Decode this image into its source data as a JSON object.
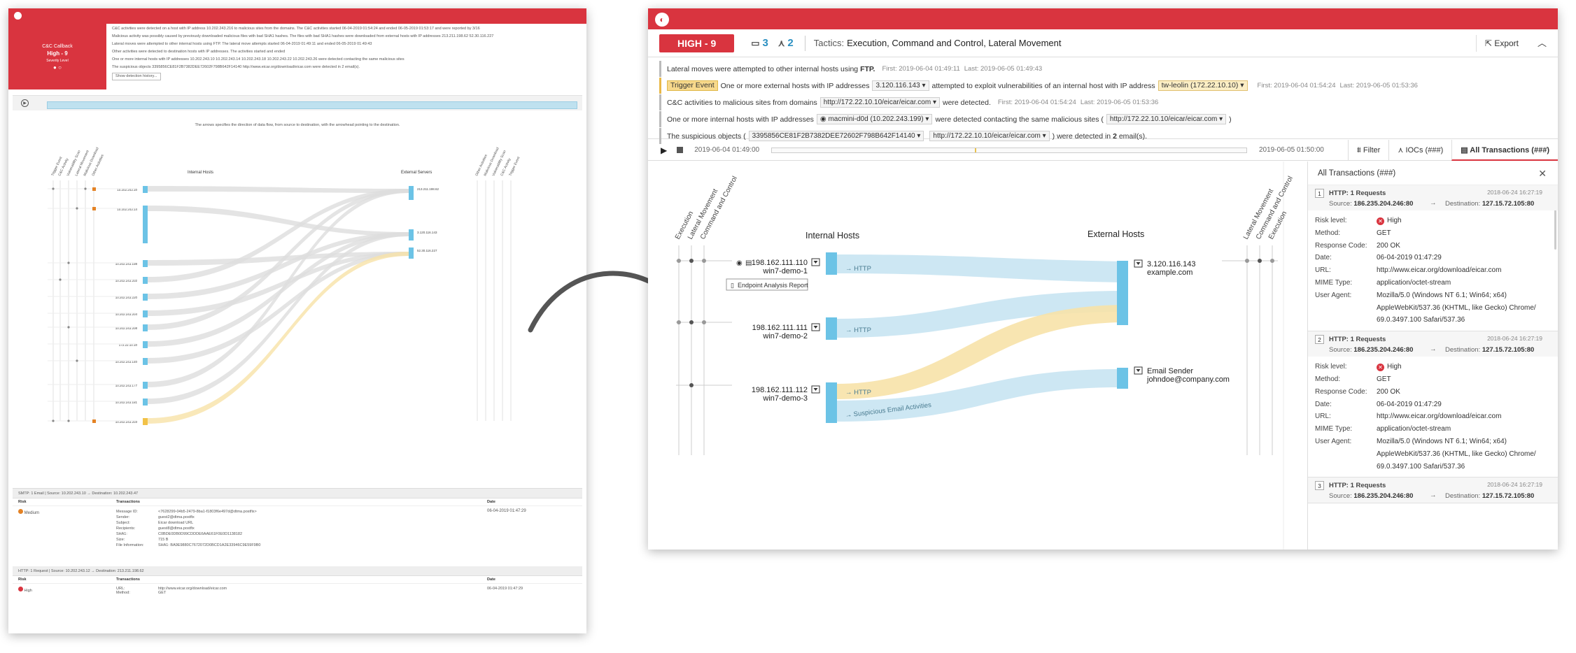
{
  "left": {
    "card": {
      "title": "C&C Callback",
      "level": "High - 9",
      "sub": "Severity Level"
    },
    "summary": [
      "C&C activities were detected on a host with IP address 10.202.243.216 to malicious sites from the domains. The C&C activities started 06-04-2019 01:54:24 and ended 06-05-2019 01:53:17 and were reported by 3/16",
      "Malicious activity was possibly caused by previously downloaded malicious files with bad SHA1 hashes. The files with bad SHA1 hashes were downloaded from external hosts with IP addresses 213.211.198.62 52.30.116.227",
      "Lateral moves were attempted to other internal hosts using FTP. The lateral move attempts started 06-04-2019 01:49:11 and ended 06-05-2019 01:49:43",
      "Other activities were detected to destination hosts with IP addresses. The activities started and ended",
      "One or more internal hosts with IP addresses 10.202.243.10 10.202.243.14 10.202.243.18 10.202.243.22 10.202.243.26 were detected contacting the same malicious sites",
      "The suspicious objects 3395856CE81F2B7382DEE72602F798B642F14140 http://www.eicar.org/download/eicar.com were detected in 2 email(s)."
    ],
    "history_button": "Show detection history...",
    "caption": "The arrows specifies the direction of data flow, from source to destination, with the arrowhead pointing to the destination.",
    "col_internal": "Internal Hosts",
    "col_external": "External Servers",
    "left_cols": [
      "Trigger Event",
      "C&C Activity",
      "Vulnerability Scan",
      "Lateral Movement",
      "Malicious Download",
      "Other Activities"
    ],
    "right_cols": [
      "Other Activities",
      "Malicious Download",
      "Vulnerability Scan",
      "C&C Activity",
      "Trigger Event"
    ],
    "hosts": [
      "10.202.243.10",
      "10.202.243.14",
      "10.202.243.198",
      "10.202.243.202",
      "10.202.243.220",
      "10.202.243.204",
      "10.202.243.208",
      "172.22.10.10",
      "10.202.243.140",
      "10.202.243.177",
      "10.202.243.181",
      "10.202.243.203"
    ],
    "servers": [
      "213.211.198.62",
      "3.120.116.143",
      "52.30.116.227"
    ],
    "table1": {
      "head": "SMTP: 1 Email | Source: 10.202.243.10 → Destination: 10.202.243.47",
      "risk": "Medium",
      "date": "06-04-2019 01:47:29",
      "rows": [
        [
          "Message ID:",
          "<7628299-04b5-2479-8ba1-f1803f6e497d@dtma.postfix>"
        ],
        [
          "Sender:",
          "guest2@dtma.postfix"
        ],
        [
          "Subject:",
          "Eicar download URL"
        ],
        [
          "Recipients:",
          "guest8@dtma.postfix"
        ],
        [
          "SHA1:",
          "C0BDE0DB0D99CDDDE6AAE61F0E0D1138182"
        ],
        [
          "Size:",
          "715 B"
        ],
        [
          "File Information:",
          "SHA1: BA9E9880C7672072D0BCD1A2E33946C9E59F9B0"
        ]
      ]
    },
    "table2": {
      "head": "HTTP: 1 Request | Source: 10.202.243.12 → Destination: 213.211.198.62",
      "risk": "High",
      "date": "06-04-2019 01:47:29",
      "url": "http://www.eicar.org/download/eicar.com",
      "method": "GET"
    },
    "th": [
      "Risk",
      "Transactions",
      "Date"
    ]
  },
  "header": {
    "severity": "HIGH - 9",
    "hosts_count": "3",
    "tactic_count": "2",
    "tactics_label": "Tactics:",
    "tactics": "Execution, Command and Control, Lateral Movement",
    "export": "Export"
  },
  "summary": {
    "l1": {
      "a": "Lateral moves were attempted to other internal hosts using",
      "b": "FTP.",
      "first": "First: 2019-06-04 01:49:11",
      "last": "Last: 2019-06-05 01:49:43"
    },
    "l2": {
      "trigger": "Trigger Event",
      "a": "One or more external hosts with IP addresses",
      "ip": "3.120.116.143",
      "b": "attempted to exploit vulnerabilities of an internal host with IP address",
      "host": "tw-leolin (172.22.10.10)",
      "first": "First: 2019-06-04 01:54:24",
      "last": "Last: 2019-06-05 01:53:36"
    },
    "l3": {
      "a": "C&C activities to malicious sites from domains",
      "url": "http://172.22.10.10/eicar/eicar.com",
      "b": "were detected.",
      "first": "First: 2019-06-04 01:54:24",
      "last": "Last: 2019-06-05 01:53:36"
    },
    "l4": {
      "a": "One or more internal hosts with IP addresses",
      "host": "macmini-d0d (10.202.243.199)",
      "b": "were detected contacting the same malicious sites (",
      "url": "http://172.22.10.10/eicar/eicar.com",
      "c": ")"
    },
    "l5": {
      "a": "The suspicious objects (",
      "hash": "3395856CE81F2B7382DEE72602F798B642F14140",
      "url": "http://172.22.10.10/eicar/eicar.com",
      "b": ") were detected in",
      "n": "2",
      "c": "email(s)."
    }
  },
  "timeline": {
    "start": "2019-06-04 01:49:00",
    "end": "2019-06-05 01:50:00",
    "tabs": [
      "Filter",
      "IOCs (###)",
      "All Transactions (###)"
    ]
  },
  "graph": {
    "internal_title": "Internal Hosts",
    "external_title": "External Hosts",
    "left_cols": [
      "Execution",
      "Lateral Movement",
      "Command and Control"
    ],
    "right_cols": [
      "Lateral Movement",
      "Command and Control",
      "Execution"
    ],
    "hosts": [
      {
        "ip": "198.162.111.110",
        "name": "win7-demo-1"
      },
      {
        "ip": "198.162.111.111",
        "name": "win7-demo-2"
      },
      {
        "ip": "198.162.111.112",
        "name": "win7-demo-3"
      }
    ],
    "servers": [
      {
        "a": "3.120.116.143",
        "b": "example.com"
      },
      {
        "a": "Email Sender",
        "b": "johndoe@company.com"
      }
    ],
    "flows": [
      "→ HTTP",
      "→ HTTP",
      "→ HTTP",
      "→ Suspicious Email Activities"
    ],
    "tooltip": "Endpoint Analysis Report"
  },
  "panel": {
    "title": "All Transactions (###)",
    "labels": {
      "risk": "Risk level:",
      "method": "Method:",
      "code": "Response Code:",
      "date": "Date:",
      "url": "URL:",
      "mime": "MIME Type:",
      "ua": "User Agent:",
      "src": "Source:",
      "dst": "Destination:"
    },
    "cards": [
      {
        "n": "1",
        "title": "HTTP: 1 Requests",
        "dt": "2018-06-24 16:27:19",
        "src": "186.235.204.246:80",
        "dst": "127.15.72.105:80",
        "risk": "High",
        "method": "GET",
        "code": "200 OK",
        "date": "06-04-2019 01:47:29",
        "url": "http://www.eicar.org/download/eicar.com",
        "mime": "application/octet-stream",
        "ua1": "Mozilla/5.0 (Windows NT 6.1; Win64; x64)",
        "ua2": "AppleWebKit/537.36 (KHTML, like Gecko) Chrome/",
        "ua3": "69.0.3497.100 Safari/537.36"
      },
      {
        "n": "2",
        "title": "HTTP: 1 Requests",
        "dt": "2018-06-24 16:27:19",
        "src": "186.235.204.246:80",
        "dst": "127.15.72.105:80",
        "risk": "High",
        "method": "GET",
        "code": "200 OK",
        "date": "06-04-2019 01:47:29",
        "url": "http://www.eicar.org/download/eicar.com",
        "mime": "application/octet-stream",
        "ua1": "Mozilla/5.0 (Windows NT 6.1; Win64; x64)",
        "ua2": "AppleWebKit/537.36 (KHTML, like Gecko) Chrome/",
        "ua3": "69.0.3497.100 Safari/537.36"
      },
      {
        "n": "3",
        "title": "HTTP: 1 Requests",
        "dt": "2018-06-24 16:27:19",
        "src": "186.235.204.246:80",
        "dst": "127.15.72.105:80"
      }
    ]
  },
  "colors": {
    "brand": "#d9343f",
    "flow_blue": "#bcdfef",
    "flow_yellow": "#f7e2a8",
    "node": "#6cc3e6"
  }
}
